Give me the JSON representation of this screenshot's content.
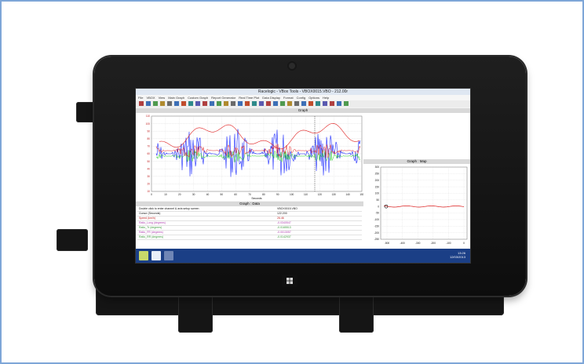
{
  "window": {
    "title": "Racelogic - VBox Tools - VBOX0015.VBO - 212.00r",
    "menu": [
      "File",
      "VBOX",
      "View",
      "Main Graph",
      "Custom Graph",
      "Report Generator",
      "Real Time Plot",
      "Data Display",
      "Format",
      "Config",
      "Options",
      "Help"
    ]
  },
  "graph": {
    "header": "Graph",
    "x_label": "Seconds",
    "x_ticks": [
      "0",
      "10",
      "20",
      "30",
      "40",
      "50",
      "60",
      "70",
      "80",
      "90",
      "100",
      "110",
      "120",
      "130",
      "140",
      "150"
    ],
    "y_ticks": [
      "110",
      "100",
      "90",
      "80",
      "70",
      "60",
      "50",
      "40",
      "30",
      "20",
      "10"
    ]
  },
  "data_panel": {
    "header": "Graph : Data",
    "rows": [
      {
        "label": "Double click to enter channel & axis setup screen",
        "value": "VBOX0015.VBO"
      },
      {
        "label": "Cursor (Seconds)",
        "value": "122.200"
      },
      {
        "label": "Speed (km/h)",
        "value": "26.46"
      },
      {
        "label": "Ratio_Long (degrees)",
        "value": "-0.0340547"
      },
      {
        "label": "Ratio_Tr (degrees)",
        "value": "-0.0165513"
      },
      {
        "label": "Ratio_FR (degrees)",
        "value": "-0.0013057"
      },
      {
        "label": "Ratio_RR (degrees)",
        "value": "-0.0142937"
      }
    ]
  },
  "map_panel": {
    "header": "Graph : Map",
    "y_ticks": [
      "300",
      "250",
      "200",
      "150",
      "100",
      "50",
      "0",
      "-50",
      "-100",
      "-150",
      "-200",
      "-250"
    ],
    "x_ticks": [
      "-500",
      "-400",
      "-300",
      "-200",
      "-100",
      "0"
    ]
  },
  "taskbar": {
    "time": "13:26",
    "date": "12/03/2013"
  },
  "colors": {
    "blue_series": "#1e2cff",
    "red_series": "#e02020",
    "green_series": "#22cc22",
    "taskbar": "#1b3f86"
  }
}
